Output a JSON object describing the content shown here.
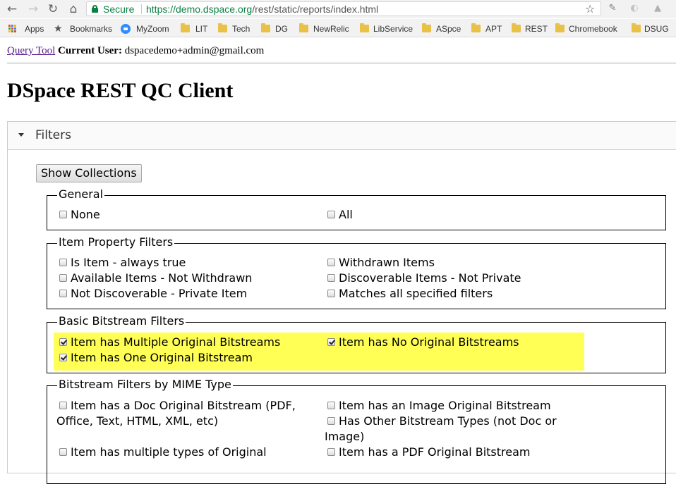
{
  "browser": {
    "secure_label": "Secure",
    "url_host": "https://demo.dspace.org",
    "url_path": "/rest/static/reports/index.html",
    "bookmarks": [
      {
        "label": "Apps"
      },
      {
        "label": "Bookmarks"
      },
      {
        "label": "MyZoom"
      },
      {
        "label": "LIT"
      },
      {
        "label": "Tech"
      },
      {
        "label": "DG"
      },
      {
        "label": "NewRelic"
      },
      {
        "label": "LibService"
      },
      {
        "label": "ASpce"
      },
      {
        "label": "APT"
      },
      {
        "label": "REST"
      },
      {
        "label": "Chromebook"
      },
      {
        "label": "DSUG"
      }
    ]
  },
  "page": {
    "query_tool_link": "Query Tool",
    "current_user_label": "Current User:",
    "current_user": "dspacedemo+admin@gmail.com",
    "title": "DSpace REST QC Client"
  },
  "filters": {
    "header": "Filters",
    "show_collections_button": "Show Collections",
    "groups": [
      {
        "legend": "General",
        "options": [
          {
            "label": "None",
            "checked": false
          },
          {
            "label": "All",
            "checked": false
          }
        ]
      },
      {
        "legend": "Item Property Filters",
        "options": [
          {
            "label": "Is Item - always true",
            "checked": false
          },
          {
            "label": "Withdrawn Items",
            "checked": false
          },
          {
            "label": "Available Items - Not Withdrawn",
            "checked": false
          },
          {
            "label": "Discoverable Items - Not Private",
            "checked": false
          },
          {
            "label": "Not Discoverable - Private Item",
            "checked": false
          },
          {
            "label": "Matches all specified filters",
            "checked": false
          }
        ]
      },
      {
        "legend": "Basic Bitstream Filters",
        "options": [
          {
            "label": "Item has Multiple Original Bitstreams",
            "checked": true
          },
          {
            "label": "Item has No Original Bitstreams",
            "checked": true
          },
          {
            "label": "Item has One Original Bitstream",
            "checked": true
          }
        ]
      },
      {
        "legend": "Bitstream Filters by MIME Type",
        "options": [
          {
            "label": "Item has a Doc Original Bitstream (PDF, Office, Text, HTML, XML, etc)",
            "checked": false
          },
          {
            "label": "Item has an Image Original Bitstream",
            "checked": false
          },
          {
            "label": "Has Other Bitstream Types (not Doc or Image)",
            "checked": false
          },
          {
            "label": "Item has multiple types of Original",
            "checked": false
          },
          {
            "label": "Item has a PDF Original Bitstream",
            "checked": false
          }
        ]
      }
    ]
  }
}
